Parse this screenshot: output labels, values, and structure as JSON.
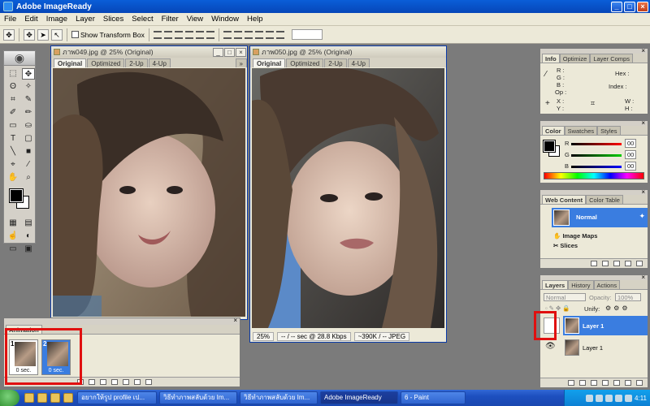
{
  "window": {
    "title": "Adobe ImageReady"
  },
  "menu": [
    "File",
    "Edit",
    "Image",
    "Layer",
    "Slices",
    "Select",
    "Filter",
    "View",
    "Window",
    "Help"
  ],
  "options": {
    "show_transform_box": "Show Transform Box"
  },
  "doc1": {
    "title": "ภาพ049.jpg @ 25% (Original)",
    "tabs": [
      "Original",
      "Optimized",
      "2-Up",
      "4-Up"
    ]
  },
  "doc2": {
    "title": "ภาพ050.jpg @ 25% (Original)",
    "tabs": [
      "Original",
      "Optimized",
      "2-Up",
      "4-Up"
    ],
    "status": {
      "zoom": "25%",
      "speed": "-- / -- sec @ 28.8 Kbps",
      "format": "~390K / -- JPEG"
    }
  },
  "info_panel": {
    "tabs": [
      "Info",
      "Optimize",
      "Layer Comps"
    ],
    "r": "R :",
    "g": "G :",
    "b": "B :",
    "op": "Op :",
    "hex": "Hex :",
    "index": "Index :",
    "x": "X :",
    "y": "Y :",
    "w": "W :",
    "h": "H :"
  },
  "color_panel": {
    "tabs": [
      "Color",
      "Swatches",
      "Styles"
    ],
    "r_label": "R",
    "g_label": "G",
    "b_label": "B",
    "r_val": "00",
    "g_val": "00",
    "b_val": "00"
  },
  "web_panel": {
    "tabs": [
      "Web Content",
      "Color Table"
    ],
    "normal": "Normal",
    "image_maps": "Image Maps",
    "slices": "Slices"
  },
  "layers_panel": {
    "tabs": [
      "Layers",
      "History",
      "Actions"
    ],
    "blend": "Normal",
    "opacity_label": "Opacity:",
    "opacity": "100%",
    "unify": "Unify:",
    "layers": [
      {
        "name": "Layer 1"
      },
      {
        "name": "Layer 1"
      }
    ]
  },
  "animation": {
    "title": "Animation",
    "frames": [
      {
        "num": "1",
        "delay": "0 sec."
      },
      {
        "num": "2",
        "delay": "0 sec."
      }
    ]
  },
  "taskbar": {
    "tasks": [
      "อยากให้รูป profile เป...",
      "วิธีทำภาพสลับด้วย Im...",
      "วิธีทำภาพสลับด้วย Im...",
      "Adobe ImageReady",
      "6 - Paint"
    ],
    "clock": "4:11"
  }
}
